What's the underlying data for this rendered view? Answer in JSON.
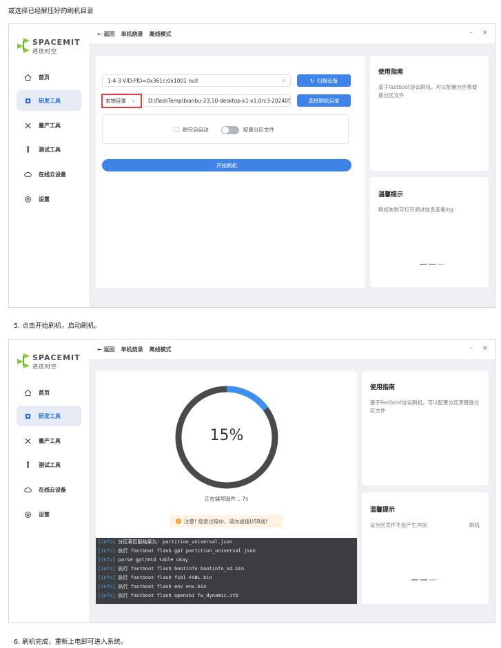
{
  "captions": {
    "top": "或选择已经解压好的刷机目录",
    "step5": "5. 点击开始刷机，启动刷机。",
    "step6": "6. 刷机完成，重新上电即可进入系统。"
  },
  "app": {
    "logo_text": "SPACEMIT",
    "logo_sub": "进迭时空",
    "topbar": {
      "back": "← 返回",
      "single": "单机烧录",
      "offline": "离线模式",
      "minimize": "–",
      "close": "×"
    },
    "nav": [
      {
        "label": "首页",
        "icon": "home-icon"
      },
      {
        "label": "研发工具",
        "icon": "device-icon"
      },
      {
        "label": "量产工具",
        "icon": "tools-icon"
      },
      {
        "label": "测试工具",
        "icon": "test-tube-icon"
      },
      {
        "label": "在线云设备",
        "icon": "cloud-icon"
      },
      {
        "label": "设置",
        "icon": "settings-icon"
      }
    ],
    "accent": "#3d83e8",
    "watermark": "sipeed"
  },
  "screen1": {
    "device_select": "1-4-3 VID:PID=0x361c:0x1001 null",
    "scan_button": "扫描设备",
    "local_dir": "本地目录",
    "path": "D:\\flashTemp\\bianbu-23.10-desktop-k1-v1.0rc3-202405",
    "choose_dir_button": "选择刷机目录",
    "reboot_option": "刷完自启动",
    "partition_option": "配置分区文件",
    "start_button": "开始刷机",
    "guide_title": "使用指南",
    "guide_text": "基于fastboot协议刷机，可以配置分区表替换分区文件",
    "tips_title": "温馨提示",
    "tips_text": "刷机失败可打开调试信息查看log"
  },
  "screen2": {
    "progress_percent": 15,
    "progress_label": "15%",
    "status": "正在烧写固件... 7s",
    "warning": "注意! 烧录过程中，请勿拔插USB线!",
    "log": [
      {
        "tag": "[info]",
        "text": " 分区表匹配结果为: partition_universal.json"
      },
      {
        "tag": "[info]",
        "text": " 执行 fastboot flash gpt partition_universal.json"
      },
      {
        "tag": "[info]",
        "text": " parse gpt/mtd table okay"
      },
      {
        "tag": "[info]",
        "text": " 执行 fastboot flash bootinfo bootinfo_sd.bin"
      },
      {
        "tag": "[info]",
        "text": " 执行 fastboot flash fsbl FSBL.bin"
      },
      {
        "tag": "[info]",
        "text": " 执行 fastboot flash env env.bin"
      },
      {
        "tag": "[info]",
        "text": " 执行 fastboot flash opensbi fw_dynamic.itb"
      }
    ],
    "guide_title": "使用指南",
    "guide_text": "基于fastboot协议刷机，可以配置分区表替换分区文件",
    "tips_title": "温馨提示",
    "tips_text": "证分区文件不会产生冲突",
    "tips_text_right": "刷机"
  }
}
